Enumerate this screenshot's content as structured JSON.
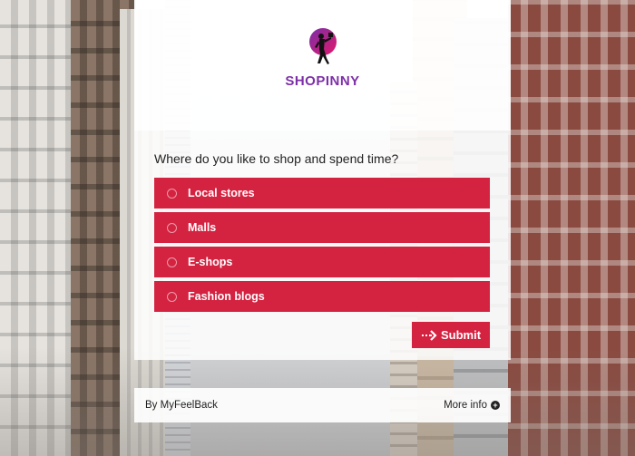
{
  "brand": {
    "name": "SHOPINNY",
    "logo_icon": "shopper-silhouette-icon",
    "colors": {
      "accent": "#d42341",
      "brand_purple": "#7d2fa8",
      "logo_circle": "#b4186e"
    }
  },
  "survey": {
    "question": "Where do you like to shop and spend time?",
    "options": [
      {
        "label": "Local stores"
      },
      {
        "label": "Malls"
      },
      {
        "label": "E-shops"
      },
      {
        "label": "Fashion blogs"
      }
    ],
    "submit_label": "Submit",
    "submit_icon": "dashed-arrow-right-icon"
  },
  "footer": {
    "credit": "By MyFeelBack",
    "more_info_label": "More info",
    "more_info_icon": "plus-circle-icon"
  }
}
